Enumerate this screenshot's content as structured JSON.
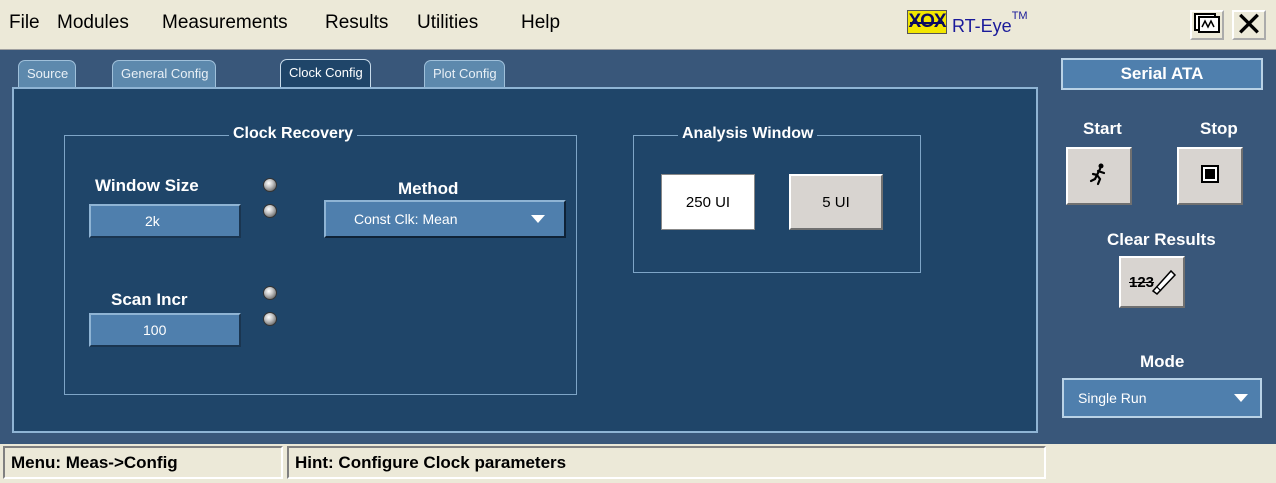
{
  "menubar": {
    "items": [
      "File",
      "Modules",
      "Measurements",
      "Results",
      "Utilities",
      "Help"
    ],
    "logo_text": "XOX",
    "app_title": "RT-Eye",
    "app_title_tm": "TM"
  },
  "tabs": [
    {
      "label": "Source"
    },
    {
      "label": "General Config"
    },
    {
      "label": "Clock Config"
    },
    {
      "label": "Plot Config"
    }
  ],
  "active_tab": "Clock Config",
  "clock_recovery": {
    "title": "Clock Recovery",
    "window_size_label": "Window Size",
    "window_size_value": "2k",
    "method_label": "Method",
    "method_value": "Const Clk: Mean",
    "scan_incr_label": "Scan Incr",
    "scan_incr_value": "100"
  },
  "analysis_window": {
    "title": "Analysis Window",
    "options": [
      "250 UI",
      "5 UI"
    ],
    "selected": "250 UI"
  },
  "right_panel": {
    "standard": "Serial ATA",
    "start_label": "Start",
    "stop_label": "Stop",
    "clear_results_label": "Clear Results",
    "clear_icon_text": "123",
    "mode_label": "Mode",
    "mode_value": "Single Run"
  },
  "statusbar": {
    "menu_path": "Menu: Meas->Config",
    "hint": "Hint: Configure Clock parameters"
  },
  "colors": {
    "panel_bg": "#39577a",
    "tab_body": "#1f4569",
    "field_bg": "#4f7fad",
    "chrome": "#ece9d8"
  }
}
